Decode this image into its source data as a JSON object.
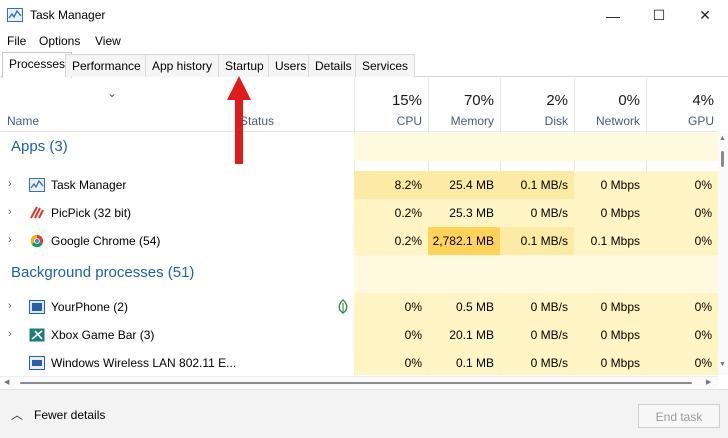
{
  "window": {
    "title": "Task Manager",
    "controls": {
      "minimize": "—",
      "maximize": "☐",
      "close": "✕"
    }
  },
  "menu": [
    "File",
    "Options",
    "View"
  ],
  "tabs": [
    {
      "label": "Processes",
      "active": true
    },
    {
      "label": "Performance"
    },
    {
      "label": "App history"
    },
    {
      "label": "Startup"
    },
    {
      "label": "Users"
    },
    {
      "label": "Details"
    },
    {
      "label": "Services"
    }
  ],
  "header": {
    "sort_indicator": "⌄",
    "name": "Name",
    "status": "Status",
    "columns": [
      {
        "pct": "15%",
        "label": "CPU"
      },
      {
        "pct": "70%",
        "label": "Memory"
      },
      {
        "pct": "2%",
        "label": "Disk"
      },
      {
        "pct": "0%",
        "label": "Network"
      },
      {
        "pct": "4%",
        "label": "GPU"
      }
    ]
  },
  "groups": {
    "apps": "Apps (3)",
    "background": "Background processes (51)"
  },
  "rows": [
    {
      "name": "Task Manager",
      "icon": "task-manager-icon",
      "cpu": "8.2%",
      "memory": "25.4 MB",
      "disk": "0.1 MB/s",
      "network": "0 Mbps",
      "gpu": "0%"
    },
    {
      "name": "PicPick (32 bit)",
      "icon": "picpick-icon",
      "cpu": "0.2%",
      "memory": "25.3 MB",
      "disk": "0 MB/s",
      "network": "0 Mbps",
      "gpu": "0%"
    },
    {
      "name": "Google Chrome (54)",
      "icon": "chrome-icon",
      "cpu": "0.2%",
      "memory": "2,782.1 MB",
      "disk": "0.1 MB/s",
      "network": "0.1 Mbps",
      "gpu": "0%"
    },
    {
      "name": "YourPhone (2)",
      "icon": "yourphone-icon",
      "cpu": "0%",
      "memory": "0.5 MB",
      "disk": "0 MB/s",
      "network": "0 Mbps",
      "gpu": "0%"
    },
    {
      "name": "Xbox Game Bar (3)",
      "icon": "xbox-icon",
      "cpu": "0%",
      "memory": "20.1 MB",
      "disk": "0 MB/s",
      "network": "0 Mbps",
      "gpu": "0%"
    },
    {
      "name": "Windows Wireless LAN 802.11 E...",
      "icon": "wlan-icon",
      "cpu": "0%",
      "memory": "0.1 MB",
      "disk": "0 MB/s",
      "network": "0 Mbps",
      "gpu": "0%"
    }
  ],
  "footer": {
    "fewer_details": "Fewer details",
    "end_task": "End task"
  },
  "colors": {
    "accent_blue": "#1f5fa8",
    "annotation_arrow": "#e01b1b",
    "heat_low": "#fff4c4",
    "heat_mid": "#fdeaa5",
    "heat_high": "#ffd35a"
  }
}
